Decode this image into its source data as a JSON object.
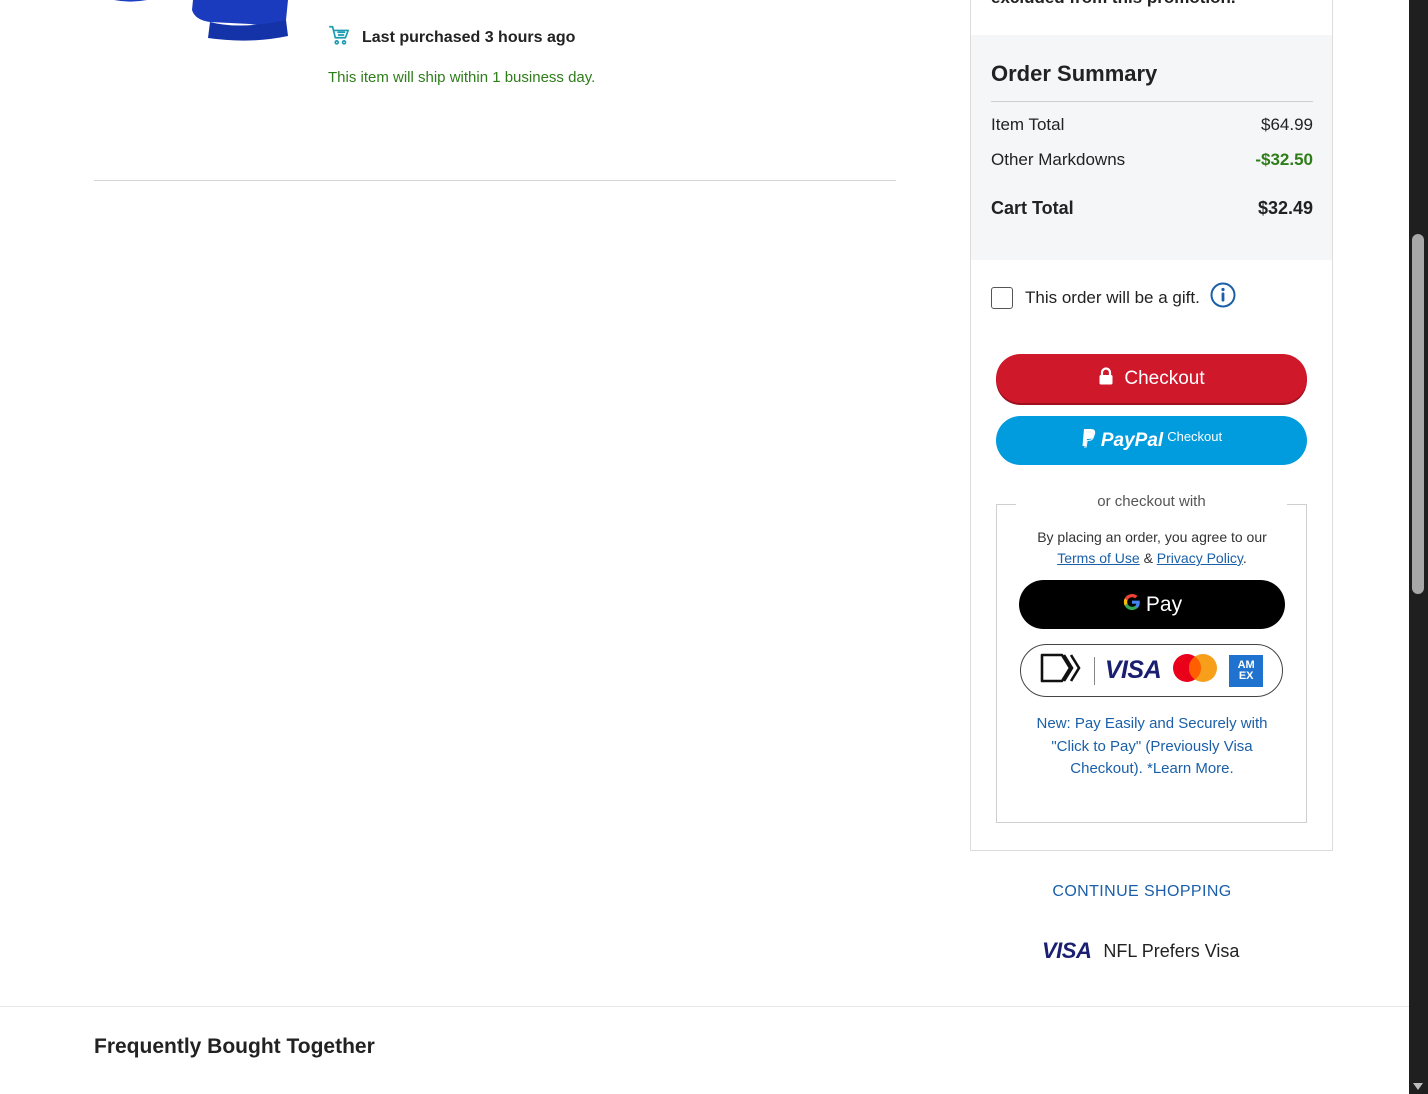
{
  "product": {
    "purchase_icon": "cart-icon",
    "last_purchased": "Last purchased 3 hours ago",
    "ship_note": "This item will ship within 1 business day."
  },
  "summary": {
    "promo_excerpt": "excluded from this promotion.",
    "title": "Order Summary",
    "rows": [
      {
        "label": "Item Total",
        "value": "$64.99"
      },
      {
        "label": "Other Markdowns",
        "value": "-$32.50"
      },
      {
        "label": "Cart Total",
        "value": "$32.49"
      }
    ]
  },
  "gift": {
    "label": "This order will be a gift.",
    "checked": false
  },
  "buttons": {
    "checkout": "Checkout",
    "paypal_brand": "PayPal",
    "paypal_sub": "Checkout",
    "gpay": "Pay"
  },
  "alt_checkout": {
    "heading": "or checkout with",
    "agree_prefix": "By placing an order, you agree to our",
    "terms": "Terms of Use",
    "amp": "&",
    "privacy": "Privacy Policy",
    "period": ".",
    "visa": "VISA",
    "amex": "AM EX",
    "new_pay_text": "New: Pay Easily and Securely with \"Click to Pay\" (Previously Visa Checkout). *Learn More."
  },
  "footer": {
    "continue": "CONTINUE SHOPPING",
    "visa_logo": "VISA",
    "nfl_visa": "NFL Prefers Visa",
    "fbt_title": "Frequently Bought Together"
  },
  "colors": {
    "checkout_red": "#d0182b",
    "paypal_blue": "#009cde",
    "link_blue": "#1a5fa8",
    "success_green": "#2e7d1a"
  }
}
